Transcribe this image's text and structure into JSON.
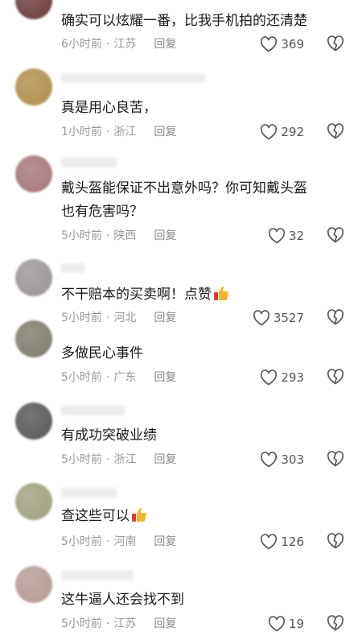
{
  "reply_label": "回复",
  "separator": "·",
  "colors": {
    "text": "#1a1a1a",
    "meta": "#9a9a9a",
    "icon": "#555555"
  },
  "comments": [
    {
      "text": "确实可以炫耀一番，比我手机拍的还清楚",
      "time": "6小时前",
      "location": "江苏",
      "likes": "369",
      "avatar_color": "#6b3a3a",
      "emoji": false
    },
    {
      "text": "真是用心良苦，",
      "time": "1小时前",
      "location": "浙江",
      "likes": "292",
      "avatar_color": "#b08d4a",
      "emoji": false
    },
    {
      "text": "戴头盔能保证不出意外吗？你可知戴头盔\n也有危害吗？",
      "time": "5小时前",
      "location": "陕西",
      "likes": "32",
      "avatar_color": "#a5767a",
      "emoji": false
    },
    {
      "text": "不干赔本的买卖啊！点赞",
      "time": "5小时前",
      "location": "河北",
      "likes": "3527",
      "avatar_color": "#9b9494",
      "emoji": true
    },
    {
      "text": "多做民心事件",
      "time": "5小时前",
      "location": "广东",
      "likes": "293",
      "avatar_color": "#7e7a6c",
      "emoji": false
    },
    {
      "text": "有成功突破业绩",
      "time": "5小时前",
      "location": "浙江",
      "likes": "303",
      "avatar_color": "#565656",
      "emoji": false
    },
    {
      "text": "查这些可以",
      "time": "5小时前",
      "location": "河南",
      "likes": "126",
      "avatar_color": "#9ea07c",
      "emoji": true
    },
    {
      "text": "这牛逼人还会找不到",
      "time": "5小时前",
      "location": "江苏",
      "likes": "19",
      "avatar_color": "#b59a92",
      "emoji": false
    }
  ]
}
